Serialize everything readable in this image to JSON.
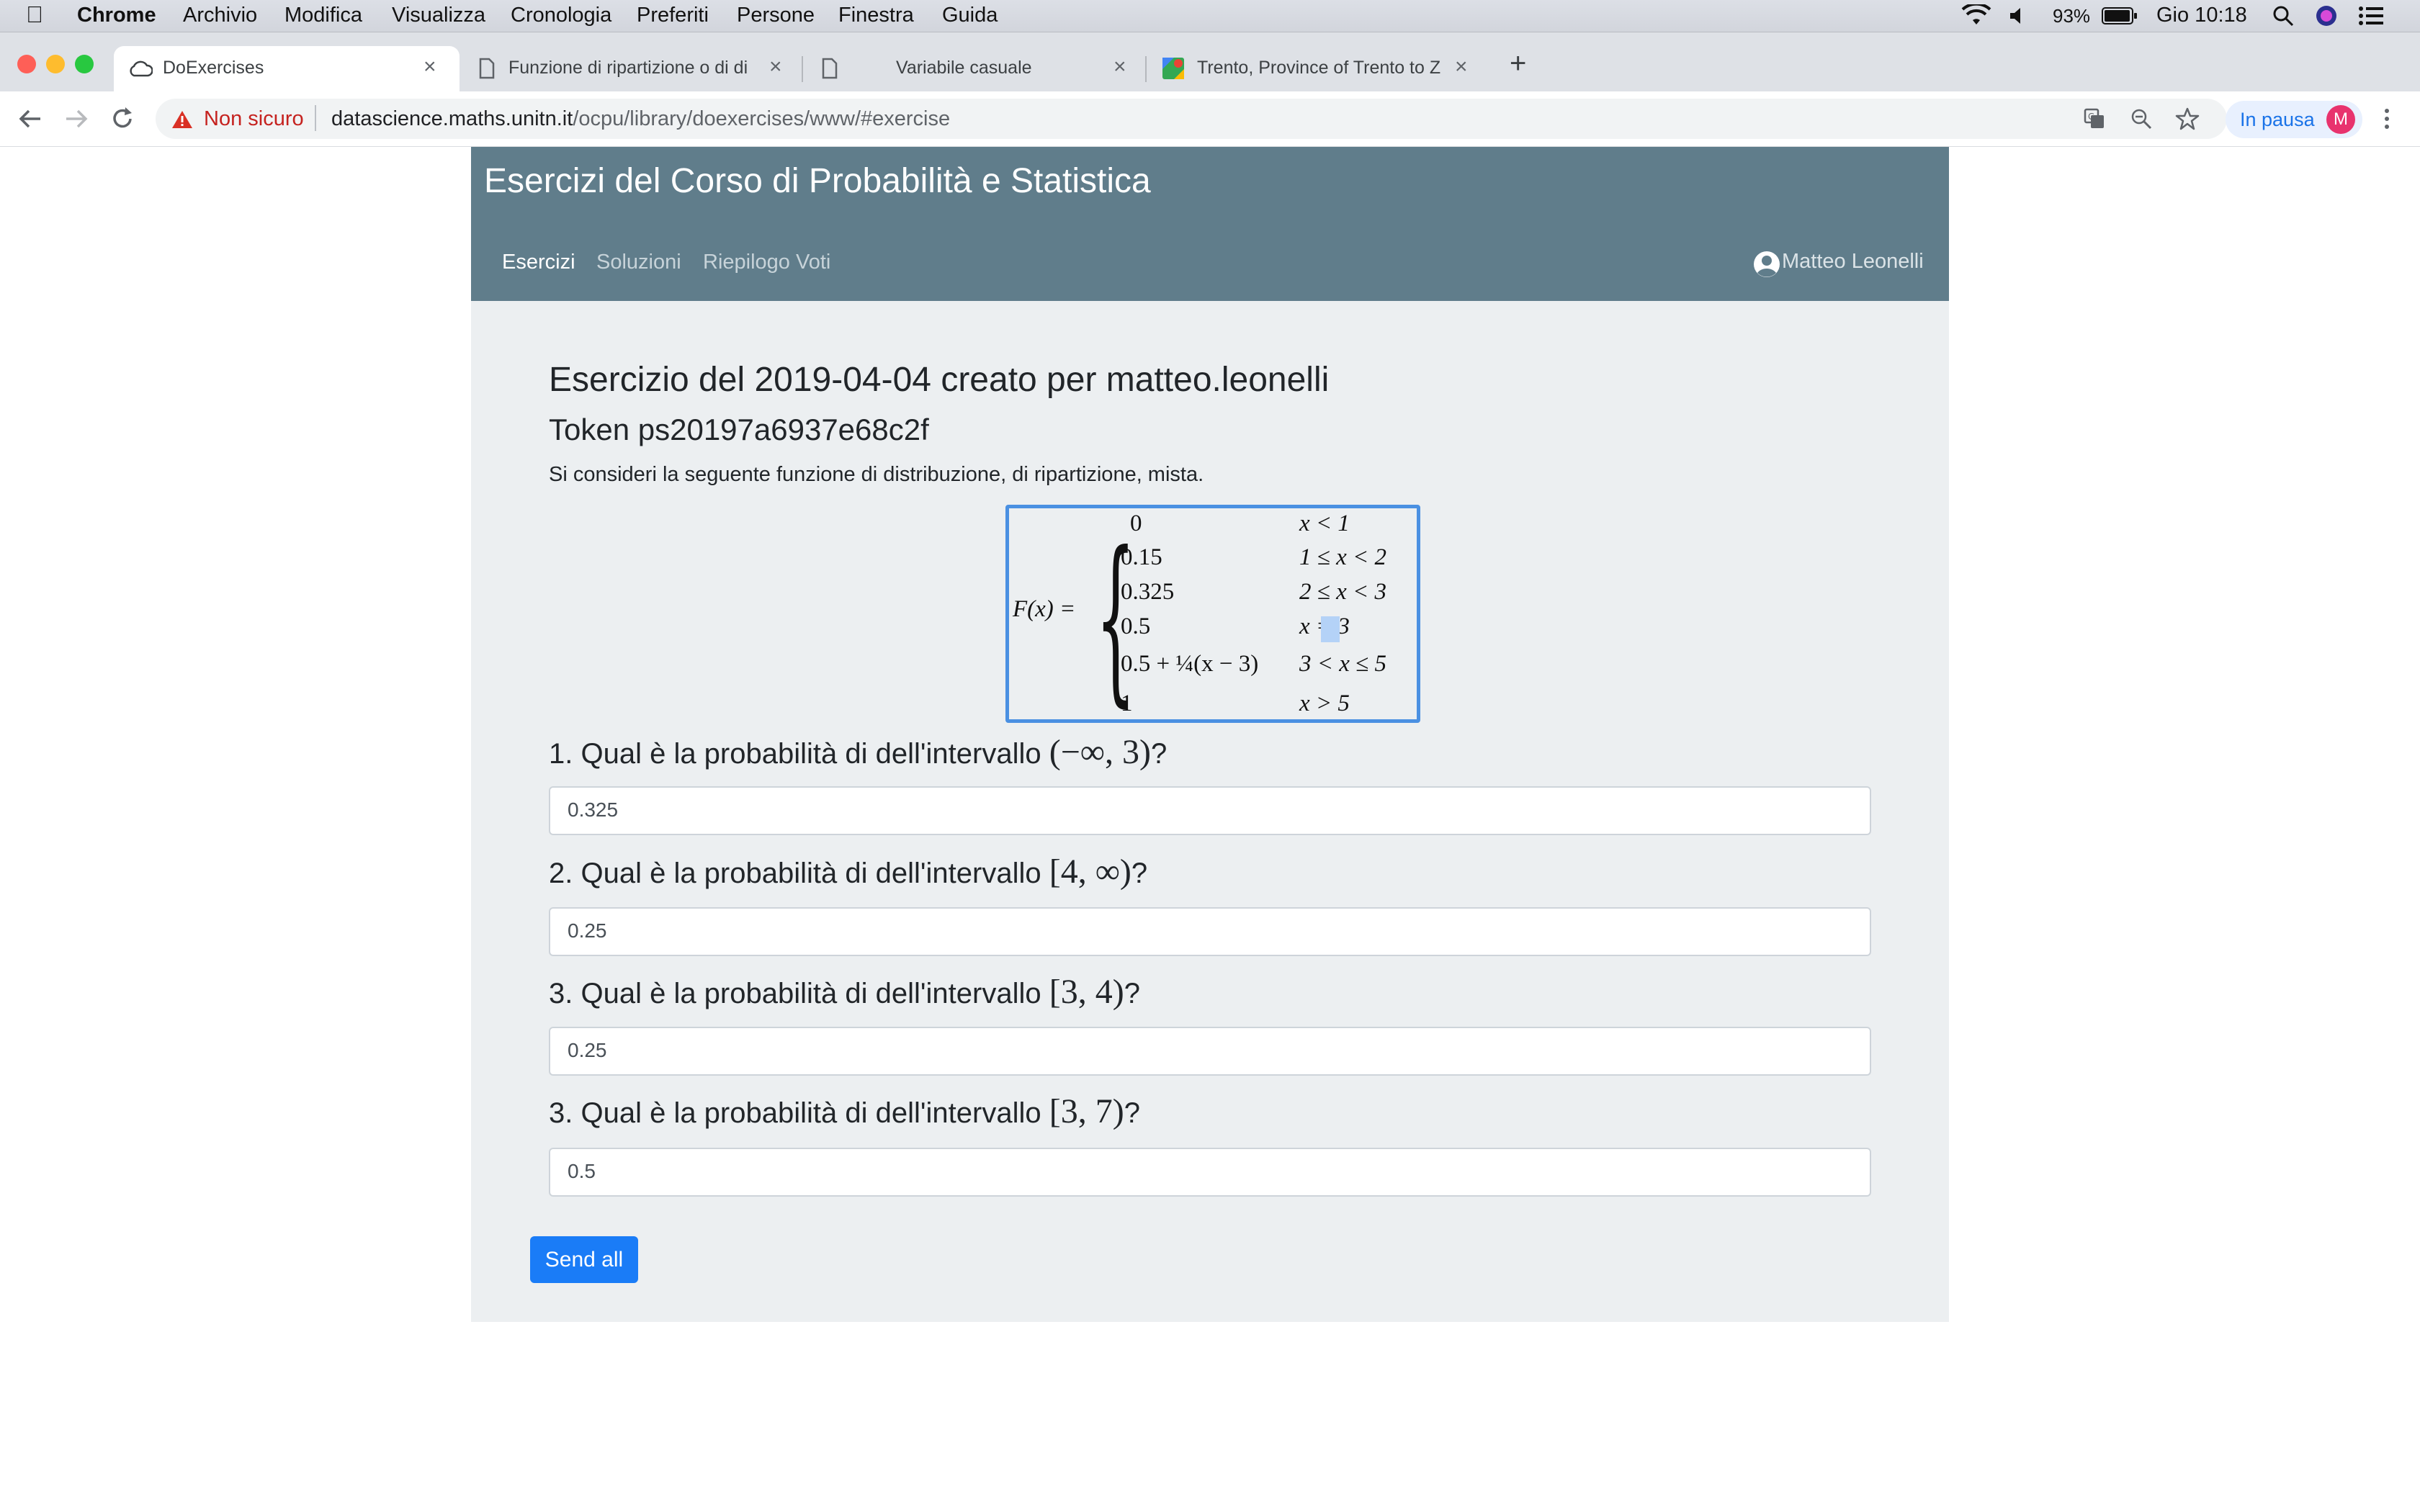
{
  "menubar": {
    "app_name": "Chrome",
    "items": [
      "Archivio",
      "Modifica",
      "Visualizza",
      "Cronologia",
      "Preferiti",
      "Persone",
      "Finestra",
      "Guida"
    ],
    "battery": "93%",
    "clock": "Gio 10:18"
  },
  "tabs": [
    {
      "title": "DoExercises",
      "icon": "cloud-icon",
      "active": true
    },
    {
      "title": "Funzione di ripartizione o di di",
      "icon": "page-icon",
      "active": false
    },
    {
      "title": "Variabile casuale",
      "icon": "page-icon",
      "active": false
    },
    {
      "title": "Trento, Province of Trento to Z",
      "icon": "maps-icon",
      "active": false
    }
  ],
  "toolbar": {
    "security_label": "Non sicuro",
    "url_host": "datascience.maths.unitn.it",
    "url_path": "/ocpu/library/doexercises/www/#exercise",
    "profile_status": "In pausa",
    "profile_initial": "M"
  },
  "header": {
    "title": "Esercizi del Corso di Probabilità e Statistica",
    "nav": [
      "Esercizi",
      "Soluzioni",
      "Riepilogo Voti"
    ],
    "user": "Matteo Leonelli"
  },
  "exercise": {
    "heading": "Esercizio del 2019-04-04 creato per matteo.leonelli",
    "token": "Token ps20197a6937e68c2f",
    "intro": "Si consideri la seguente funzione di distribuzione, di ripartizione, mista.",
    "formula": {
      "lhs": "F(x) =",
      "cases": [
        {
          "value": "0",
          "range": "x < 1"
        },
        {
          "value": "0.15",
          "range": "1 ≤ x < 2"
        },
        {
          "value": "0.325",
          "range": "2 ≤ x < 3"
        },
        {
          "value": "0.5",
          "range": "x = 3"
        },
        {
          "value": "0.5 + ¼(x − 3)",
          "range": "3 < x ≤ 5"
        },
        {
          "value": "1",
          "range": "x > 5"
        }
      ]
    },
    "questions": [
      {
        "text": "1. Qual è la probabilità di dell'intervallo ",
        "interval": "(−∞, 3)",
        "suffix": "?",
        "answer": "0.325"
      },
      {
        "text": "2. Qual è la probabilità di dell'intervallo ",
        "interval": "[4, ∞)",
        "suffix": "?",
        "answer": "0.25"
      },
      {
        "text": "3. Qual è la probabilità di dell'intervallo ",
        "interval": "[3, 4)",
        "suffix": "?",
        "answer": "0.25"
      },
      {
        "text": "3. Qual è la probabilità di dell'intervallo ",
        "interval": "[3, 7)",
        "suffix": "?",
        "answer": "0.5"
      }
    ],
    "submit_label": "Send all"
  },
  "colors": {
    "header_bg": "#607d8b",
    "body_bg": "#eceff1",
    "primary_button": "#1a7cf7",
    "formula_border": "#4a90e2"
  }
}
